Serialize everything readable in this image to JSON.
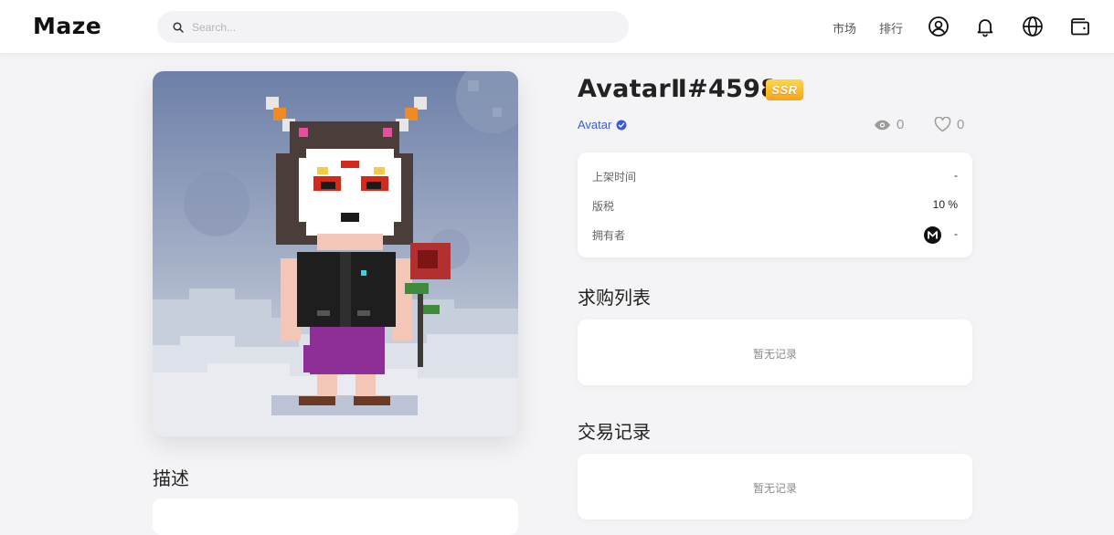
{
  "header": {
    "logo": "Maze",
    "search": {
      "placeholder": "Search...",
      "value": ""
    },
    "nav": {
      "market": "市场",
      "ranking": "排行"
    },
    "icons": [
      "user-icon",
      "bell-icon",
      "globe-icon",
      "wallet-icon"
    ]
  },
  "artwork": {
    "alt": "AvatarⅡ#4598"
  },
  "item": {
    "title": "AvatarⅡ#4598",
    "rarity": "SSR",
    "collection": "Avatar",
    "views": "0",
    "likes": "0"
  },
  "details": {
    "listed_time_label": "上架时间",
    "listed_time_value": "-",
    "royalty_label": "版税",
    "royalty_value": "10 %",
    "owner_label": "拥有者",
    "owner_value": "-"
  },
  "sections": {
    "description": "描述",
    "offers": "求购列表",
    "offers_empty": "暂无记录",
    "trades": "交易记录",
    "trades_empty": "暂无记录"
  },
  "colors": {
    "accent_link": "#3a5ad9",
    "badge_gradient_top": "#ffd54a",
    "badge_gradient_bottom": "#f7a21b",
    "page_bg": "#f4f4f6"
  }
}
